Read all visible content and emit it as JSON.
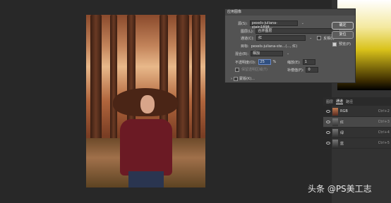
{
  "dialog": {
    "title": "应用图像",
    "source_label": "源(S):",
    "source_value": "pexels-juliana-stein1898...",
    "layer_label": "图层(L):",
    "layer_value": "合并图层",
    "channel_label": "通道(C):",
    "channel_value": "红",
    "invert_label": "反相(I)",
    "target_label": "目标:",
    "target_value": "pexels-juliana-ste...(..., 红)",
    "blending_label": "混合(B):",
    "blending_value": "相加",
    "opacity_label": "不透明度(O):",
    "opacity_value": "25",
    "opacity_unit": "%",
    "scale_label": "缩放(E):",
    "scale_value": "1",
    "offset_label": "补偿值(F):",
    "offset_value": "0",
    "preserve_transparency_label": "保留透明区域(T)",
    "mask_label": "蒙版(K)...",
    "ok_label": "确定",
    "reset_label": "复位",
    "preview_label": "预览(P)",
    "preview_checked": true
  },
  "layers_panel": {
    "tabs": [
      "图层",
      "通道",
      "路径"
    ],
    "active_tab": "通道",
    "channels": [
      {
        "name": "RGB",
        "shortcut": "Ctrl+2"
      },
      {
        "name": "红",
        "shortcut": "Ctrl+3"
      },
      {
        "name": "绿",
        "shortcut": "Ctrl+4"
      },
      {
        "name": "蓝",
        "shortcut": "Ctrl+5"
      }
    ]
  },
  "watermark": "头条 @PS美工志"
}
